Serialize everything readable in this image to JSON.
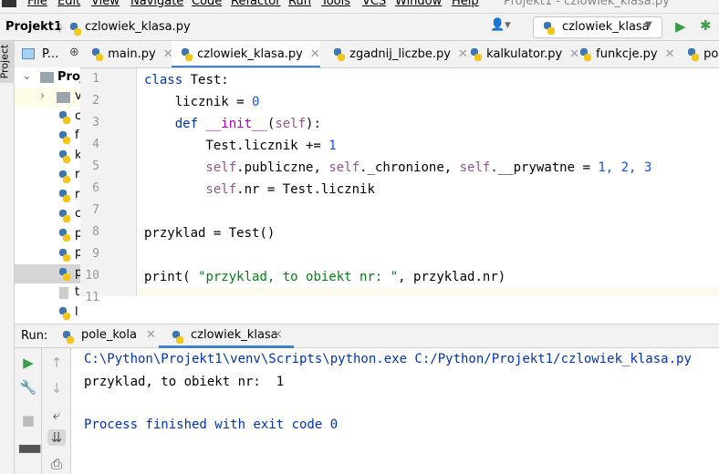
{
  "menu": [
    "File",
    "Edit",
    "View",
    "Navigate",
    "Code",
    "Refactor",
    "Run",
    "Tools",
    "VCS",
    "Window",
    "Help"
  ],
  "window_title": "Projekt1 - czlowiek_klasa.py",
  "breadcrumb": {
    "project": "Projekt1",
    "file": "czlowiek_klasa.py"
  },
  "run_config": "czlowiek_klasa",
  "left_strip_label": "Project",
  "project_panel": {
    "title": "P...",
    "root": "Proj",
    "items": [
      "v",
      "c",
      "f",
      "k",
      "r",
      "r",
      "c",
      "p",
      "p",
      "p",
      "t",
      "l"
    ]
  },
  "tabs": [
    {
      "label": "main.py"
    },
    {
      "label": "czlowiek_klasa.py",
      "active": true
    },
    {
      "label": "zgadnij_liczbe.py"
    },
    {
      "label": "kalkulator.py"
    },
    {
      "label": "funkcje.py"
    },
    {
      "label": "pol"
    }
  ],
  "line_numbers": [
    "1",
    "2",
    "3",
    "4",
    "5",
    "6",
    "7",
    "8",
    "9",
    "10",
    "11"
  ],
  "code": {
    "l1a": "class",
    "l1b": " Test:",
    "l2a": "    licznik = ",
    "l2b": "0",
    "l3a": "    def ",
    "l3b": "__init__",
    "l3c": "(",
    "l3d": "self",
    "l3e": "):",
    "l4a": "        Test.licznik += ",
    "l4b": "1",
    "l5a": "        self",
    "l5b": ".publiczne, ",
    "l5c": "self",
    "l5d": "._chronione, ",
    "l5e": "self",
    "l5f": ".__prywatne = ",
    "l5g": "1, 2, 3",
    "l6a": "        self",
    "l6b": ".nr = Test.licznik",
    "l8": "przyklad = Test()",
    "l10a": "print( ",
    "l10b": "\"przyklad, to obiekt nr: \"",
    "l10c": ", przyklad.nr)"
  },
  "run": {
    "label": "Run:",
    "tabs": [
      "pole_kola",
      "czlowiek_klasa"
    ],
    "output": [
      "C:\\Python\\Projekt1\\venv\\Scripts\\python.exe C:/Python/Projekt1/czlowiek_klasa.py",
      "przyklad, to obiekt nr:  1",
      "Process finished with exit code 0"
    ]
  },
  "colors": {
    "accent": "#4083c9",
    "keyword": "#0033b3",
    "number": "#1750eb",
    "self": "#94558d",
    "string": "#067d17",
    "output_cmd": "#0033b3"
  }
}
